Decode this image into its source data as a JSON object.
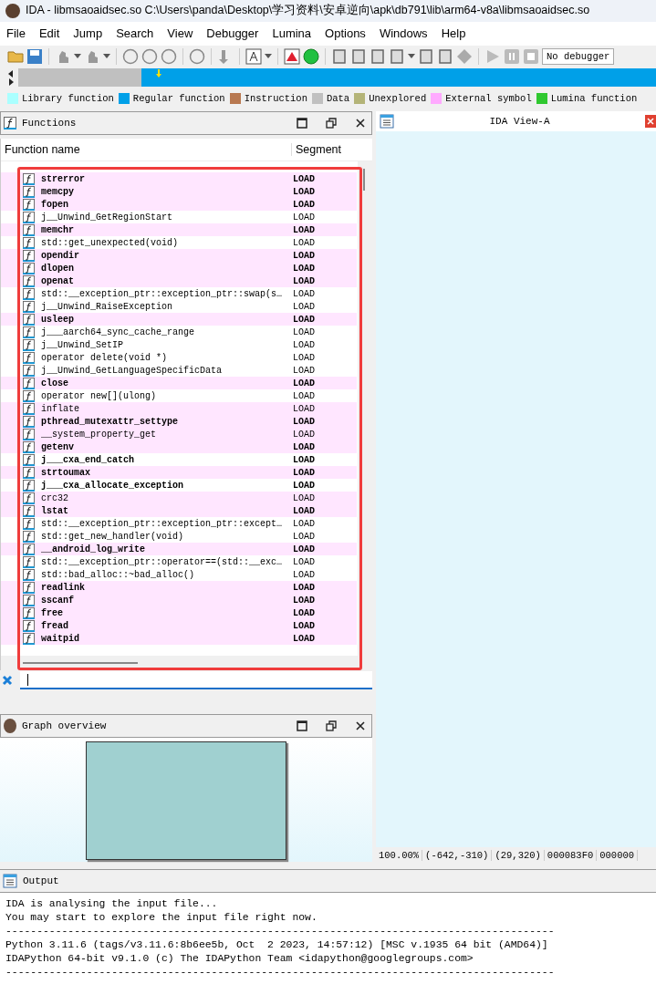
{
  "window": {
    "title": "IDA - libmsaoaidsec.so C:\\Users\\panda\\Desktop\\学习资料\\安卓逆向\\apk\\db791\\lib\\arm64-v8a\\libmsaoaidsec.so"
  },
  "menu": [
    "File",
    "Edit",
    "Jump",
    "Search",
    "View",
    "Debugger",
    "Lumina",
    "Options",
    "Windows",
    "Help"
  ],
  "toolbar": {
    "debugger_select": "No debugger"
  },
  "legend": [
    {
      "label": "Library function",
      "color": "#aaffff"
    },
    {
      "label": "Regular function",
      "color": "#00a0e8"
    },
    {
      "label": "Instruction",
      "color": "#b87850"
    },
    {
      "label": "Data",
      "color": "#c0c0c0"
    },
    {
      "label": "Unexplored",
      "color": "#b4b478"
    },
    {
      "label": "External symbol",
      "color": "#ffaaff"
    },
    {
      "label": "Lumina function",
      "color": "#30c830"
    }
  ],
  "functions_panel": {
    "title": "Functions",
    "columns": [
      "Function name",
      "Segment"
    ],
    "rows": [
      {
        "name": "strerror",
        "segment": "LOAD",
        "bold": true,
        "highlighted": true
      },
      {
        "name": "memcpy",
        "segment": "LOAD",
        "bold": true,
        "highlighted": true
      },
      {
        "name": "fopen",
        "segment": "LOAD",
        "bold": true,
        "highlighted": true
      },
      {
        "name": "j__Unwind_GetRegionStart",
        "segment": "LOAD",
        "bold": false,
        "highlighted": false
      },
      {
        "name": "memchr",
        "segment": "LOAD",
        "bold": true,
        "highlighted": true
      },
      {
        "name": "std::get_unexpected(void)",
        "segment": "LOAD",
        "bold": false,
        "highlighted": false
      },
      {
        "name": "opendir",
        "segment": "LOAD",
        "bold": true,
        "highlighted": true
      },
      {
        "name": "dlopen",
        "segment": "LOAD",
        "bold": true,
        "highlighted": true
      },
      {
        "name": "openat",
        "segment": "LOAD",
        "bold": true,
        "highlighted": true
      },
      {
        "name": "std::__exception_ptr::exception_ptr::swap(s…",
        "segment": "LOAD",
        "bold": false,
        "highlighted": false
      },
      {
        "name": "j__Unwind_RaiseException",
        "segment": "LOAD",
        "bold": false,
        "highlighted": false
      },
      {
        "name": "usleep",
        "segment": "LOAD",
        "bold": true,
        "highlighted": true
      },
      {
        "name": "j___aarch64_sync_cache_range",
        "segment": "LOAD",
        "bold": false,
        "highlighted": false
      },
      {
        "name": "j__Unwind_SetIP",
        "segment": "LOAD",
        "bold": false,
        "highlighted": false
      },
      {
        "name": "operator delete(void *)",
        "segment": "LOAD",
        "bold": false,
        "highlighted": false
      },
      {
        "name": "j__Unwind_GetLanguageSpecificData",
        "segment": "LOAD",
        "bold": false,
        "highlighted": false
      },
      {
        "name": "close",
        "segment": "LOAD",
        "bold": true,
        "highlighted": true
      },
      {
        "name": "operator new[](ulong)",
        "segment": "LOAD",
        "bold": false,
        "highlighted": false
      },
      {
        "name": "inflate",
        "segment": "LOAD",
        "bold": false,
        "highlighted": true
      },
      {
        "name": "pthread_mutexattr_settype",
        "segment": "LOAD",
        "bold": true,
        "highlighted": true
      },
      {
        "name": "__system_property_get",
        "segment": "LOAD",
        "bold": false,
        "highlighted": true
      },
      {
        "name": "getenv",
        "segment": "LOAD",
        "bold": true,
        "highlighted": true
      },
      {
        "name": "j___cxa_end_catch",
        "segment": "LOAD",
        "bold": true,
        "highlighted": false
      },
      {
        "name": "strtoumax",
        "segment": "LOAD",
        "bold": true,
        "highlighted": true
      },
      {
        "name": "j___cxa_allocate_exception",
        "segment": "LOAD",
        "bold": true,
        "highlighted": false
      },
      {
        "name": "crc32",
        "segment": "LOAD",
        "bold": false,
        "highlighted": true
      },
      {
        "name": "lstat",
        "segment": "LOAD",
        "bold": true,
        "highlighted": true
      },
      {
        "name": "std::__exception_ptr::exception_ptr::except…",
        "segment": "LOAD",
        "bold": false,
        "highlighted": false
      },
      {
        "name": "std::get_new_handler(void)",
        "segment": "LOAD",
        "bold": false,
        "highlighted": false
      },
      {
        "name": "__android_log_write",
        "segment": "LOAD",
        "bold": true,
        "highlighted": true
      },
      {
        "name": "std::__exception_ptr::operator==(std::__exc…",
        "segment": "LOAD",
        "bold": false,
        "highlighted": false
      },
      {
        "name": "std::bad_alloc::~bad_alloc()",
        "segment": "LOAD",
        "bold": false,
        "highlighted": false
      },
      {
        "name": "readlink",
        "segment": "LOAD",
        "bold": true,
        "highlighted": true
      },
      {
        "name": "sscanf",
        "segment": "LOAD",
        "bold": true,
        "highlighted": true
      },
      {
        "name": "free",
        "segment": "LOAD",
        "bold": true,
        "highlighted": true
      },
      {
        "name": "fread",
        "segment": "LOAD",
        "bold": true,
        "highlighted": true
      },
      {
        "name": "waitpid",
        "segment": "LOAD",
        "bold": true,
        "highlighted": true
      }
    ]
  },
  "graph_overview": {
    "title": "Graph overview"
  },
  "ida_view": {
    "title": "IDA View-A",
    "status": [
      "100.00%",
      "(-642,-310)",
      "(29,320)",
      "000083F0",
      "000000"
    ]
  },
  "output": {
    "title": "Output",
    "lines": [
      "IDA is analysing the input file...",
      "You may start to explore the input file right now.",
      "----------------------------------------------------------------------------------------",
      "Python 3.11.6 (tags/v3.11.6:8b6ee5b, Oct  2 2023, 14:57:12) [MSC v.1935 64 bit (AMD64)]",
      "IDAPython 64-bit v9.1.0 (c) The IDAPython Team <idapython@googlegroups.com>",
      "----------------------------------------------------------------------------------------"
    ]
  }
}
